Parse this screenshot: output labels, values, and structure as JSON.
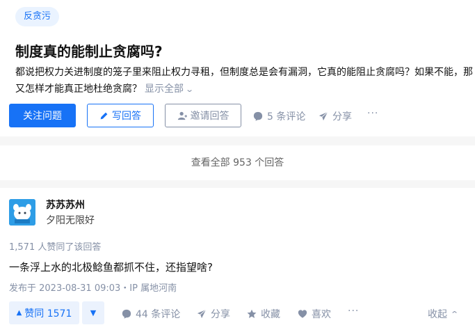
{
  "question": {
    "topic_tag": "反贪污",
    "title": "制度真的能制止贪腐吗?",
    "excerpt": "都说把权力关进制度的笼子里来阻止权力寻租，但制度总是会有漏洞，它真的能阻止贪腐吗？如果不能，那又怎样才能真正地杜绝贪腐？",
    "show_all": "显示全部",
    "actions": {
      "follow": "关注问题",
      "write": "写回答",
      "invite": "邀请回答",
      "comments": "5 条评论",
      "share": "分享",
      "more": "···"
    }
  },
  "view_all_answers": "查看全部 953 个回答",
  "answer": {
    "author": {
      "name": "苏苏苏州",
      "bio": "夕阳无限好"
    },
    "vote_summary": "1,571 人赞同了该回答",
    "content": "一条浮上水的北极鲶鱼都抓不住，还指望啥?",
    "publish_info": "发布于 2023-08-31 09:03・IP 属地河南",
    "actions": {
      "upvote": "赞同 1571",
      "comments": "44 条评论",
      "share": "分享",
      "favorite": "收藏",
      "like": "喜欢",
      "more": "···",
      "collapse": "收起"
    }
  },
  "colors": {
    "brand": "#1772f6",
    "muted": "#8590a6",
    "tag_bg": "#eaf3ff",
    "vote_bg": "#ebf2fd",
    "avatar": "#2e9de6"
  }
}
